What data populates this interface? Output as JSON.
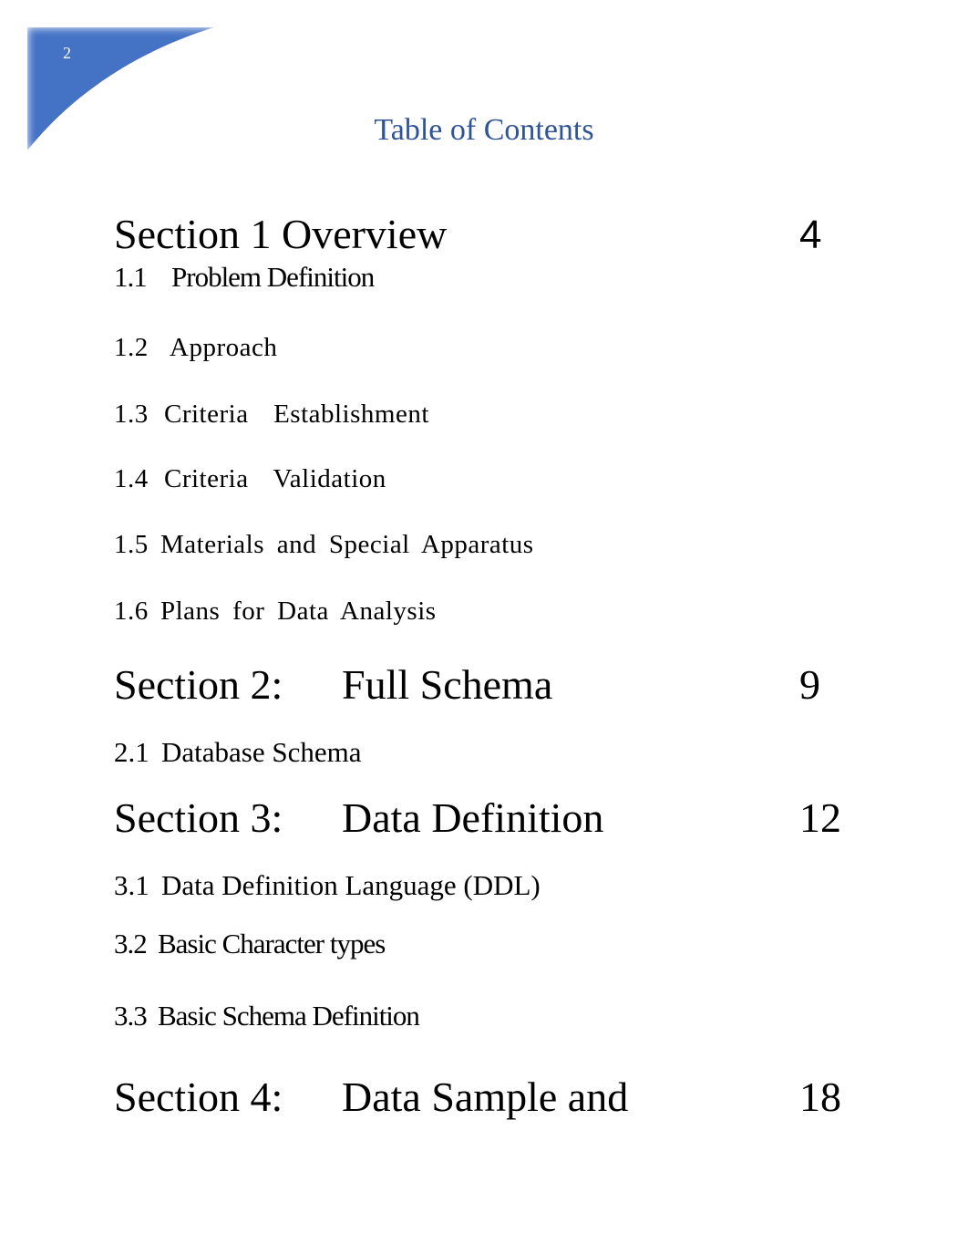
{
  "page": {
    "page_number": "2",
    "title": "Table of Contents",
    "colors": {
      "corner_accent": "#4472c4",
      "title": "#2f5496",
      "text": "#000000"
    }
  },
  "toc": {
    "sections": [
      {
        "label": "Section 1 Overview",
        "title": "",
        "page": "4",
        "subsections": [
          {
            "number": "1.1",
            "title": "Problem Definition"
          },
          {
            "number": "1.2",
            "title": "Approach"
          },
          {
            "number": "1.3",
            "title": "Criteria  Establishment"
          },
          {
            "number": "1.4",
            "title": "Criteria  Validation"
          },
          {
            "number": "1.5",
            "title": "Materials and Special Apparatus"
          },
          {
            "number": "1.6",
            "title": "Plans for Data Analysis"
          }
        ]
      },
      {
        "label": "Section 2:",
        "title": "Full Schema",
        "page": "9",
        "subsections": [
          {
            "number": "2.1",
            "title": "Database Schema"
          }
        ]
      },
      {
        "label": "Section 3:",
        "title": "Data Definition",
        "page": "12",
        "subsections": [
          {
            "number": "3.1",
            "title": "Data Definition Language (DDL)"
          },
          {
            "number": "3.2",
            "title": "Basic Character types"
          },
          {
            "number": "3.3",
            "title": "Basic Schema Definition"
          }
        ]
      },
      {
        "label": "Section 4:",
        "title": "Data Sample and",
        "page": "18",
        "subsections": []
      }
    ]
  }
}
